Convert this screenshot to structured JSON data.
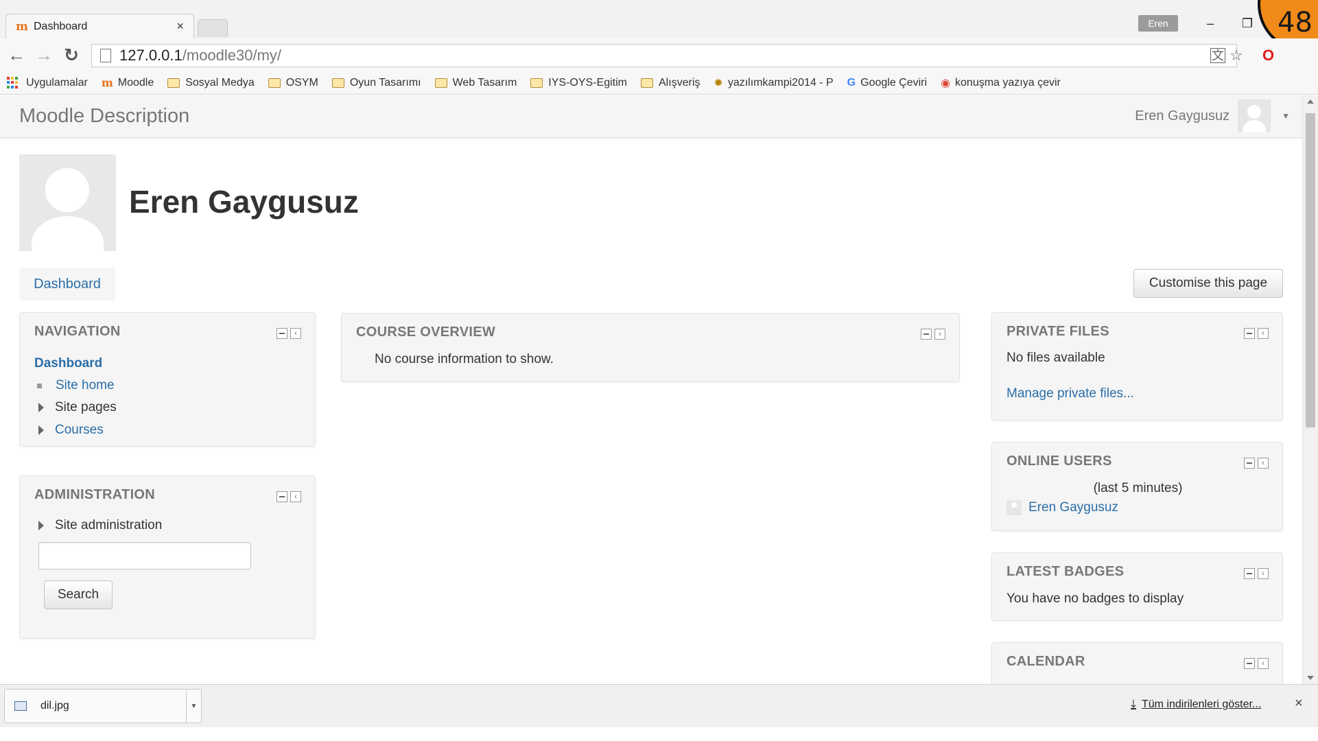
{
  "browser": {
    "tab_title": "Dashboard",
    "tab_close": "×",
    "profile_name": "Eren",
    "window_controls": {
      "minimize": "–",
      "restore": "❐"
    },
    "overlay_counter": "48",
    "address": {
      "host": "127.0.0.1",
      "path": "/moodle30/my/"
    },
    "nav_glyphs": {
      "back": "←",
      "forward": "→",
      "reload": "↻"
    },
    "omnibox_icons": [
      "translate-icon",
      "star-icon",
      "opera-icon"
    ],
    "bookmarks": [
      {
        "label": "Uygulamalar",
        "icon": "apps-grid-icon"
      },
      {
        "label": "Moodle",
        "icon": "moodle-icon"
      },
      {
        "label": "Sosyal Medya",
        "icon": "folder-icon"
      },
      {
        "label": "OSYM",
        "icon": "folder-icon"
      },
      {
        "label": "Oyun Tasarımı",
        "icon": "folder-icon"
      },
      {
        "label": "Web Tasarım",
        "icon": "folder-icon"
      },
      {
        "label": "IYS-OYS-Egitim",
        "icon": "folder-icon"
      },
      {
        "label": "Alışveriş",
        "icon": "folder-icon"
      },
      {
        "label": "yazılımkampi2014 - P",
        "icon": "site-icon"
      },
      {
        "label": "Google Çeviri",
        "icon": "google-translate-icon"
      },
      {
        "label": "konuşma yazıya çevir",
        "icon": "chrome-icon"
      }
    ]
  },
  "moodle": {
    "brand": "Moodle Description",
    "user_name": "Eren Gaygusuz",
    "profile_heading": "Eren Gaygusuz",
    "breadcrumb": "Dashboard",
    "customise_button": "Customise this page",
    "navigation": {
      "title": "NAVIGATION",
      "current": "Dashboard",
      "items": [
        "Site home",
        "Site pages",
        "Courses"
      ]
    },
    "administration": {
      "title": "ADMINISTRATION",
      "item": "Site administration",
      "search_value": "",
      "search_button": "Search"
    },
    "course_overview": {
      "title": "COURSE OVERVIEW",
      "message": "No course information to show."
    },
    "private_files": {
      "title": "PRIVATE FILES",
      "message": "No files available",
      "manage_link": "Manage private files..."
    },
    "online_users": {
      "title": "ONLINE USERS",
      "subtitle": "(last 5 minutes)",
      "users": [
        "Eren Gaygusuz"
      ]
    },
    "latest_badges": {
      "title": "LATEST BADGES",
      "message": "You have no badges to display"
    },
    "calendar": {
      "title": "CALENDAR"
    }
  },
  "downloads": {
    "file_name": "dil.jpg",
    "show_all": "Tüm indirilenleri göster...",
    "close": "×"
  },
  "colors": {
    "link": "#2a6ea8",
    "block_bg": "#f5f5f5",
    "overlay_orange": "#f08a18"
  }
}
